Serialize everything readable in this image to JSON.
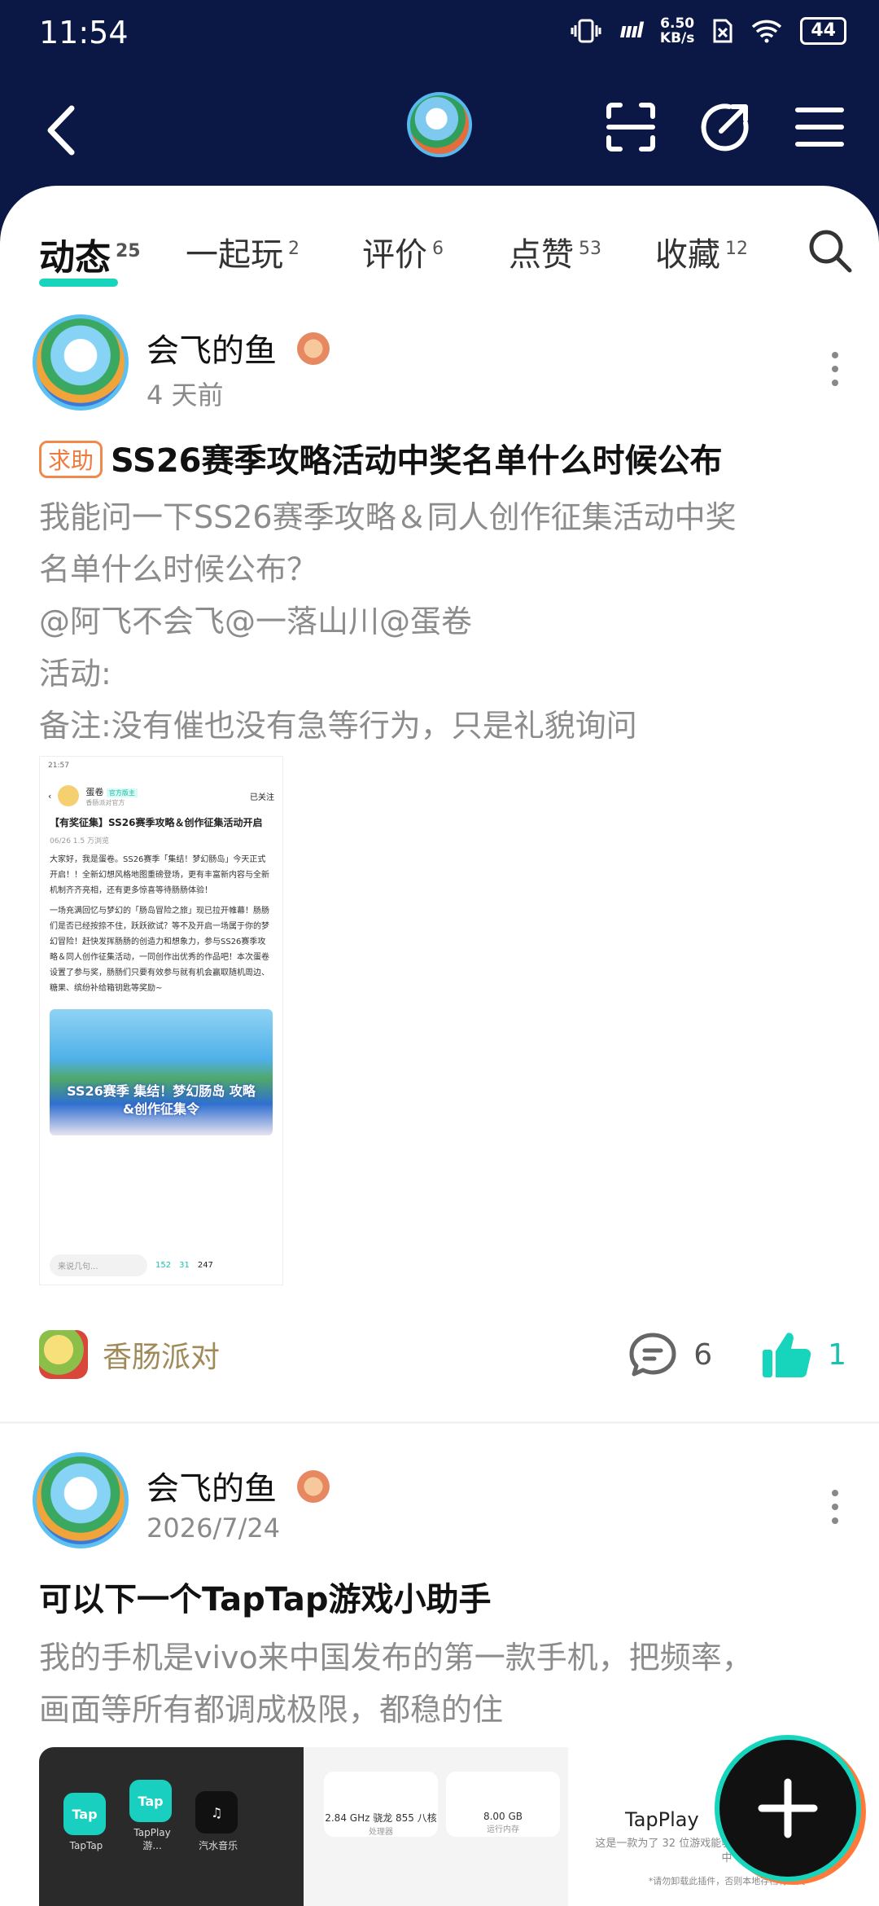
{
  "status_bar": {
    "time": "11:54",
    "signal": "ıııl",
    "speed_value": "6.50",
    "speed_unit": "KB/s",
    "battery": "44"
  },
  "tabs": [
    {
      "label": "动态",
      "count": "25"
    },
    {
      "label": "一起玩",
      "count": "2"
    },
    {
      "label": "评价",
      "count": "6"
    },
    {
      "label": "点赞",
      "count": "53"
    },
    {
      "label": "收藏",
      "count": "12"
    }
  ],
  "posts": [
    {
      "author": "会飞的鱼",
      "time": "4 天前",
      "tag": "求助",
      "title": "SS26赛季攻略活动中奖名单什么时候公布",
      "body": [
        "我能问一下SS26赛季攻略＆同人创作征集活动中奖",
        "名单什么时候公布？",
        "@阿飞不会飞@一落山川@蛋卷",
        "活动:",
        "备注:没有催也没有急等行为，只是礼貌询问"
      ],
      "embedded_screenshot": {
        "time": "21:57",
        "author": "蛋卷",
        "badge": "官方版主",
        "subtitle": "香肠派对官方",
        "follow": "已关注",
        "title": "【有奖征集】SS26赛季攻略＆创作征集活动开启",
        "meta": "06/26  1.5 万浏览",
        "paragraph1": "大家好，我是蛋卷。SS26赛季「集结！梦幻肠岛」今天正式开启！！全新幻想风格地图重磅登场，更有丰富新内容与全新机制齐齐亮相，还有更多惊喜等待肠肠体验！",
        "paragraph2": "一场充满回忆与梦幻的「肠岛冒险之旅」现已拉开帷幕！肠肠们是否已经按捺不住，跃跃欲试？等不及开启一场属于你的梦幻冒险！赶快发挥肠肠的创造力和想象力，参与SS26赛季攻略＆同人创作征集活动，一同创作出优秀的作品吧！本次蛋卷设置了参与奖，肠肠们只要有效参与就有机会赢取随机周边、糖果、缤纷补给箱钥匙等奖励~",
        "banner_text": "SS26赛季 集结！梦幻肠岛 攻略&创作征集令",
        "input_placeholder": "来说几句...",
        "likes": "152",
        "stars": "31",
        "comments": "247"
      },
      "game": "香肠派对",
      "comments": "6",
      "likes": "1"
    },
    {
      "author": "会飞的鱼",
      "time": "2026/7/24",
      "title": "可以下一个TapTap游戏小助手",
      "body": [
        "我的手机是vivo来中国发布的第一款手机，把频率，",
        "画面等所有都调成极限，都稳的住"
      ],
      "gallery": {
        "apps": [
          {
            "name": "TapTap",
            "glyph": "Tap",
            "color": "#19d0c0"
          },
          {
            "name": "TapPlay游...",
            "glyph": "Tap",
            "color": "#19d0c0"
          },
          {
            "name": "汽水音乐",
            "glyph": "♫",
            "color": "#111111"
          }
        ],
        "specs": [
          {
            "value": "2.84 GHz 骁龙 855 八核",
            "label": "处理器"
          },
          {
            "value": "8.00 GB",
            "label": "运行内存"
          }
        ],
        "tp_title": "TapPlay",
        "tp_desc": "这是一款为了 32 位游戏能够...游戏本地存档保存在插件中",
        "tp_note": "*请勿卸载此插件，否则本地存档将丢失"
      }
    }
  ],
  "colors": {
    "accent": "#17d4bc",
    "header_bg": "#0b1846",
    "tag": "#f07a3a"
  }
}
